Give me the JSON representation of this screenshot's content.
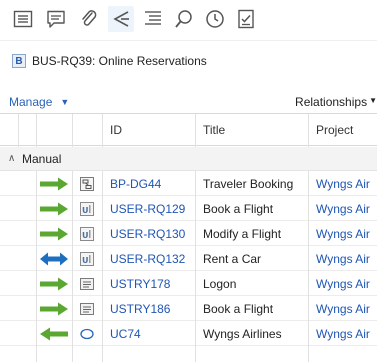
{
  "toolbar": {
    "buttons": [
      {
        "icon": "details-icon"
      },
      {
        "icon": "comments-icon"
      },
      {
        "icon": "attachment-icon"
      },
      {
        "icon": "relationships-icon",
        "active": true
      },
      {
        "icon": "outline-icon"
      },
      {
        "icon": "search-icon"
      },
      {
        "icon": "history-icon"
      },
      {
        "icon": "review-icon"
      }
    ]
  },
  "requirement": {
    "badge": "B",
    "title": "BUS-RQ39: Online Reservations"
  },
  "actions": {
    "manage_label": "Manage",
    "relationships_label": "Relationships"
  },
  "grid": {
    "columns": [
      "ID",
      "Title",
      "Project"
    ],
    "group_label": "Manual",
    "rows": [
      {
        "direction": "right",
        "type": "diagram",
        "id": "BP-DG44",
        "title": "Traveler Booking",
        "project": "Wyngs Air"
      },
      {
        "direction": "right",
        "type": "ui",
        "id": "USER-RQ129",
        "title": "Book a Flight",
        "project": "Wyngs Air"
      },
      {
        "direction": "right",
        "type": "ui",
        "id": "USER-RQ130",
        "title": "Modify a Flight",
        "project": "Wyngs Air"
      },
      {
        "direction": "both",
        "type": "ui",
        "id": "USER-RQ132",
        "title": "Rent a Car",
        "project": "Wyngs Air"
      },
      {
        "direction": "right",
        "type": "story",
        "id": "USTRY178",
        "title": "Logon",
        "project": "Wyngs Air"
      },
      {
        "direction": "right",
        "type": "story",
        "id": "USTRY186",
        "title": "Book a Flight",
        "project": "Wyngs Air"
      },
      {
        "direction": "left",
        "type": "usecase",
        "id": "UC74",
        "title": "Wyngs Airlines",
        "project": "Wyngs Air"
      }
    ]
  },
  "colors": {
    "link_blue": "#1f56b5",
    "arrow_green": "#5aa832",
    "arrow_blue": "#1f6fc0"
  }
}
